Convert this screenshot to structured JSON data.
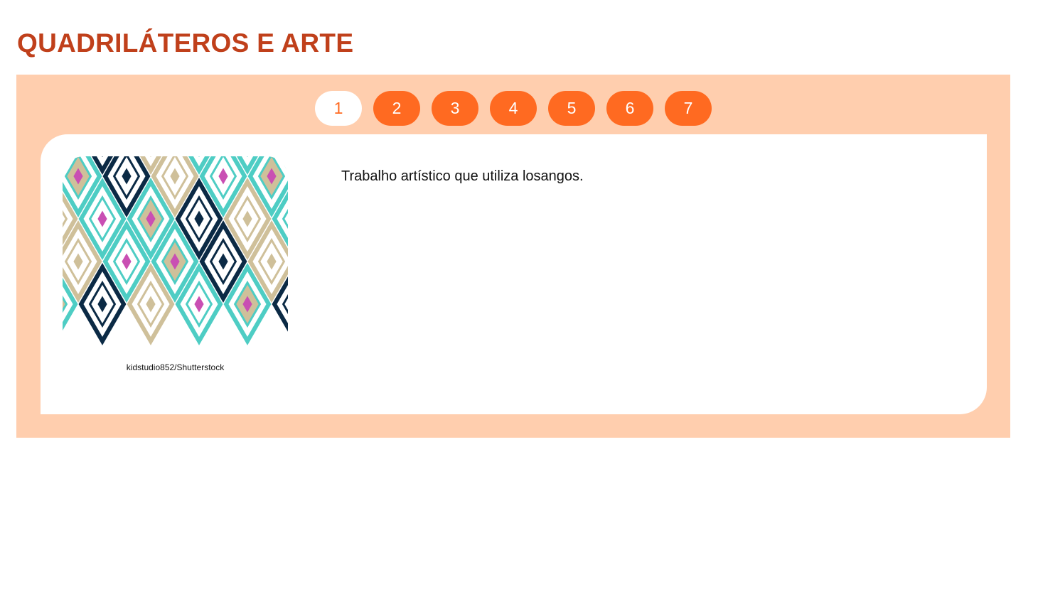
{
  "page": {
    "title": "QUADRILÁTEROS E ARTE"
  },
  "pager": {
    "active": 1,
    "pages": [
      "1",
      "2",
      "3",
      "4",
      "5",
      "6",
      "7"
    ]
  },
  "slide": {
    "image_icon": "rhombus-pattern-artwork",
    "image_credit": "kidstudio852/Shutterstock",
    "text": "Trabalho artístico que utiliza losangos."
  },
  "colors": {
    "title": "#c0401b",
    "carousel_background": "#ffceae",
    "button": "#ff6a21",
    "button_active_bg": "#ffffff",
    "pattern_teal": "#4ecdc4",
    "pattern_navy": "#0b2a45",
    "pattern_tan": "#cfc09a",
    "pattern_magenta": "#c94fb3"
  }
}
